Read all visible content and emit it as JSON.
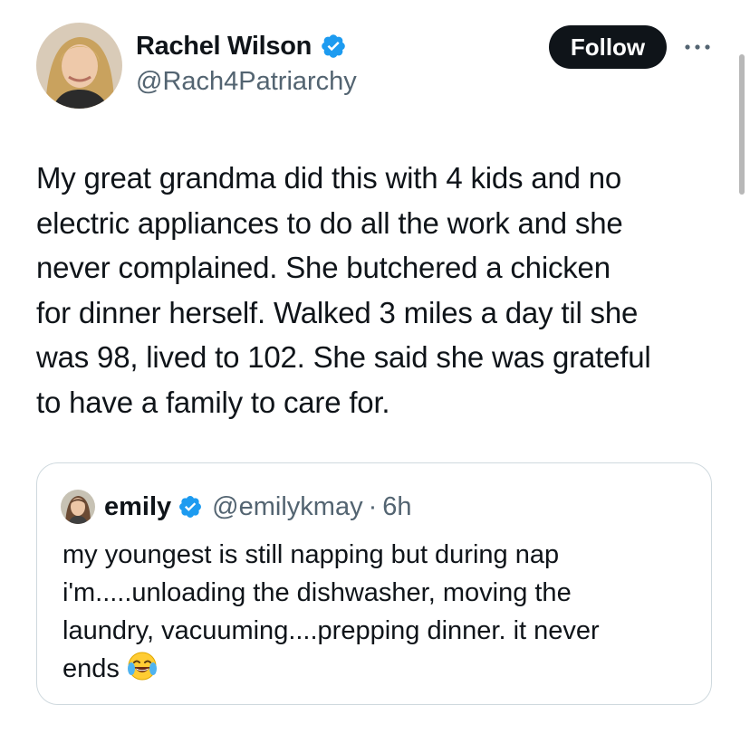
{
  "author": {
    "display_name": "Rachel Wilson",
    "handle": "@Rach4Patriarchy",
    "verified": true,
    "avatar_icon": "user-avatar"
  },
  "actions": {
    "follow_label": "Follow",
    "more_icon": "more-horizontal-icon"
  },
  "tweet": {
    "lines": [
      "My great grandma did this with 4 kids and no",
      "electric appliances to do all the work and she",
      "never complained. She butchered a chicken",
      "for dinner herself. Walked 3 miles a day til she",
      "was 98, lived to 102. She said she was grateful",
      "to have a family to care for."
    ]
  },
  "quote": {
    "display_name": "emily",
    "handle": "@emilykmay",
    "separator": "·",
    "time": "6h",
    "verified": true,
    "lines": [
      "my youngest is still napping but during nap",
      "i'm.....unloading the dishwasher, moving the",
      "laundry, vacuuming....prepping dinner. it never",
      "ends"
    ],
    "trailing_emoji": "face-with-tears-of-joy-emoji"
  },
  "colors": {
    "text_primary": "#0f1419",
    "text_secondary": "#536471",
    "verified_blue": "#1d9bf0",
    "follow_bg": "#0f1419",
    "border": "#cfd9de"
  }
}
